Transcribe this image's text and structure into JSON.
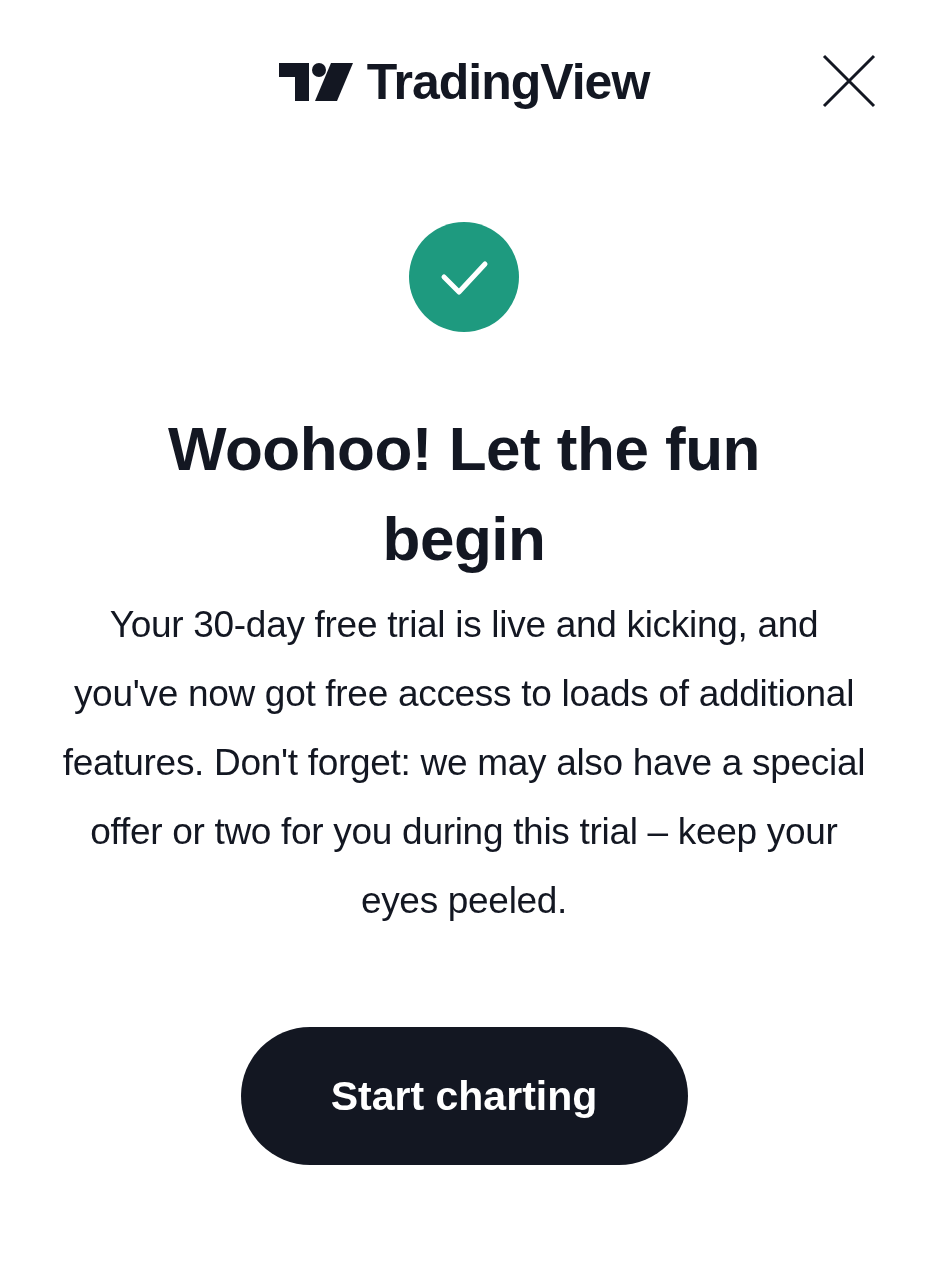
{
  "header": {
    "logo_text": "TradingView"
  },
  "title": "Woohoo! Let the fun begin",
  "message": "Your 30-day free trial is live and kicking, and you've now got free access to loads of additional features. Don't forget: we may also have a special offer or two for you during this trial – keep your eyes peeled.",
  "primary_button": {
    "label": "Start charting"
  }
}
